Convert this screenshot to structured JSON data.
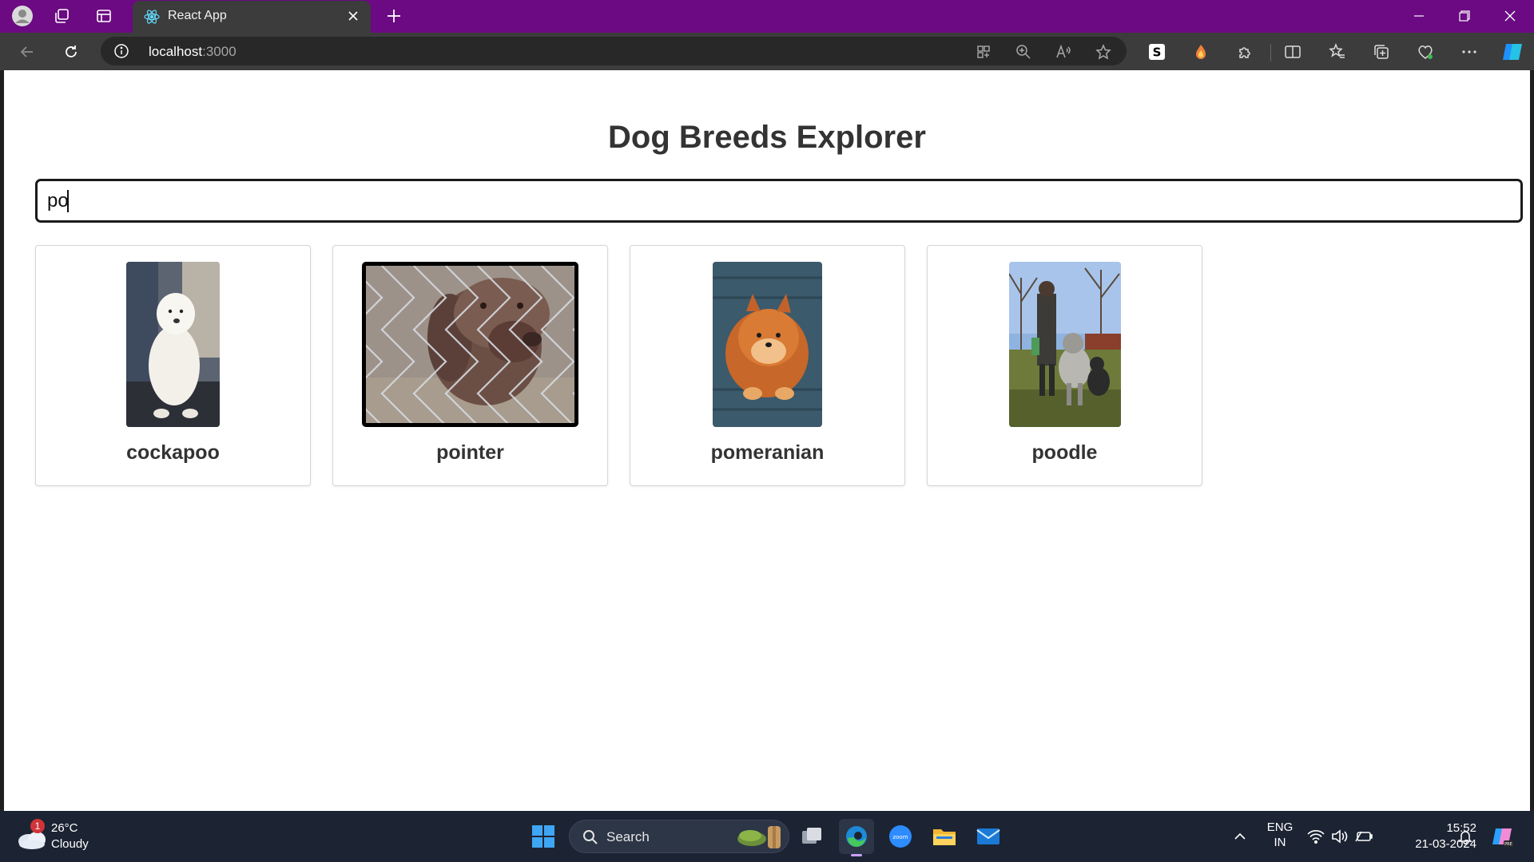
{
  "browser": {
    "tab_title": "React App",
    "url_host": "localhost",
    "url_port": ":3000",
    "accent_color": "#6b0a82"
  },
  "page": {
    "title": "Dog Breeds Explorer",
    "search_value": "po",
    "breeds": [
      {
        "name": "cockapoo",
        "image": "dog-photo"
      },
      {
        "name": "pointer",
        "image": "dog-photo"
      },
      {
        "name": "pomeranian",
        "image": "dog-photo"
      },
      {
        "name": "poodle",
        "image": "dog-photo"
      }
    ],
    "selected_card": "pointer"
  },
  "taskbar": {
    "weather_temp": "26°C",
    "weather_condition": "Cloudy",
    "weather_badge": "1",
    "search_label": "Search",
    "language_line1": "ENG",
    "language_line2": "IN",
    "time": "15:52",
    "date": "21-03-2024"
  }
}
